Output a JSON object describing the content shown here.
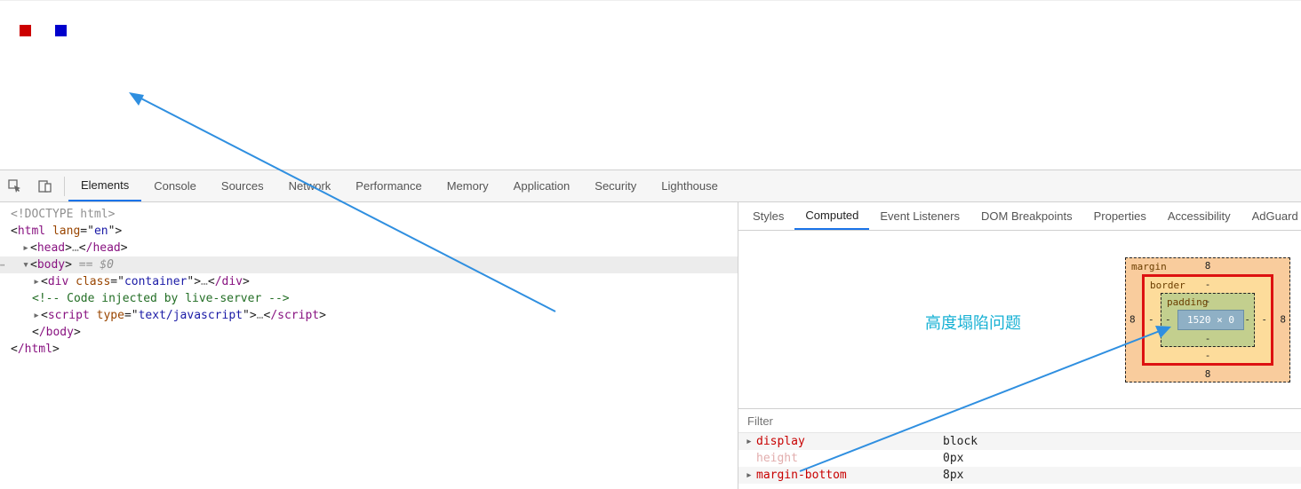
{
  "toolbar_tabs": [
    "Elements",
    "Console",
    "Sources",
    "Network",
    "Performance",
    "Memory",
    "Application",
    "Security",
    "Lighthouse"
  ],
  "toolbar_active": 0,
  "dom": {
    "doctype": "<!DOCTYPE html>",
    "html_open": "html",
    "html_attr_name": "lang",
    "html_attr_val": "en",
    "head_open": "head",
    "head_close": "/head",
    "body_open": "body",
    "body_sel": " == $0",
    "div_tag": "div",
    "div_attr_name": "class",
    "div_attr_val": "container",
    "div_close": "/div",
    "comment": " Code injected by live-server ",
    "script_tag": "script",
    "script_attr_name": "type",
    "script_attr_val": "text/javascript",
    "script_close": "/script",
    "body_close": "/body",
    "html_close": "/html",
    "ell": "…"
  },
  "side_tabs": [
    "Styles",
    "Computed",
    "Event Listeners",
    "DOM Breakpoints",
    "Properties",
    "Accessibility",
    "AdGuard"
  ],
  "side_active": 1,
  "annotation": "高度塌陷问题",
  "box": {
    "margin_label": "margin",
    "border_label": "border",
    "padding_label": "padding",
    "margin_top": "8",
    "margin_right": "8",
    "margin_bottom": "8",
    "margin_left": "8",
    "border_top": "-",
    "border_right": "-",
    "border_bottom": "-",
    "border_left": "-",
    "padding_top": "-",
    "padding_right": "-",
    "padding_bottom": "-",
    "padding_left": "-",
    "content": "1520 × 0"
  },
  "filter_placeholder": "Filter",
  "props": [
    {
      "name": "display",
      "value": "block",
      "expandable": true,
      "dim": false
    },
    {
      "name": "height",
      "value": "0px",
      "expandable": false,
      "dim": true
    },
    {
      "name": "margin-bottom",
      "value": "8px",
      "expandable": true,
      "dim": false
    }
  ]
}
